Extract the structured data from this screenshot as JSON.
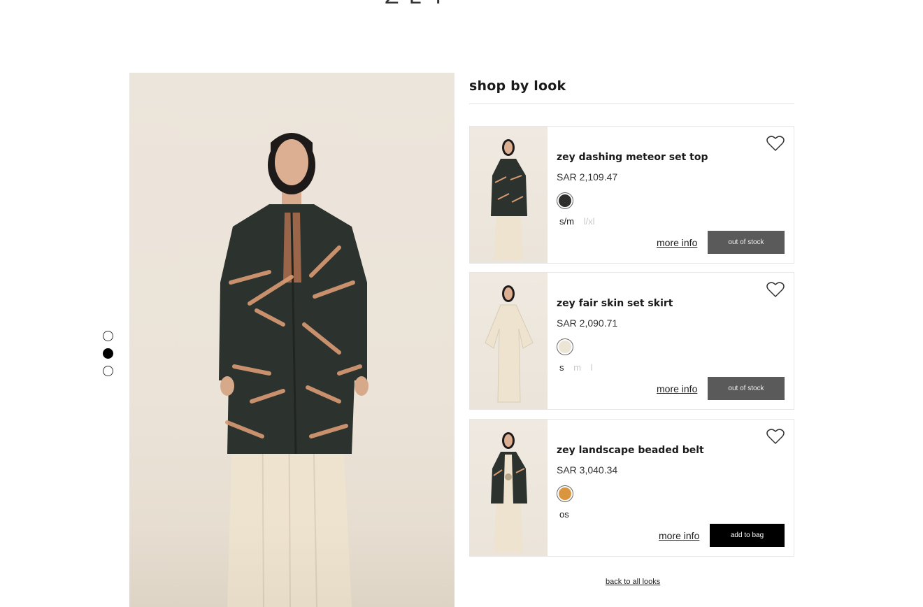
{
  "brand": {
    "logo_text": "ZEY"
  },
  "pager": {
    "count": 3,
    "active_index": 1
  },
  "panel": {
    "title": "shop by look"
  },
  "products": [
    {
      "name": "zey dashing meteor set top",
      "price": "SAR 2,109.47",
      "swatch_color": "#2f302e",
      "sizes": [
        {
          "label": "s/m",
          "available": true
        },
        {
          "label": "l/xl",
          "available": false
        }
      ],
      "more_info": "more info",
      "button": "out of stock"
    },
    {
      "name": "zey fair skin set skirt",
      "price": "SAR 2,090.71",
      "swatch_color": "#ece5d6",
      "sizes": [
        {
          "label": "s",
          "available": true
        },
        {
          "label": "m",
          "available": false
        },
        {
          "label": "l",
          "available": false
        }
      ],
      "more_info": "more info",
      "button": "out of stock"
    },
    {
      "name": "zey landscape beaded belt",
      "price": "SAR 3,040.34",
      "swatch_color": "#d9963e",
      "sizes": [
        {
          "label": "os",
          "available": true
        }
      ],
      "more_info": "more info",
      "button": "add to bag"
    }
  ],
  "back_link": "back to all looks",
  "colors": {
    "jacket": "#2c322d",
    "jacket_pattern": "#d99b73",
    "skirt": "#ede3cf",
    "out_of_stock_bg": "#5a5a5a",
    "add_to_bag_bg": "#000000"
  }
}
